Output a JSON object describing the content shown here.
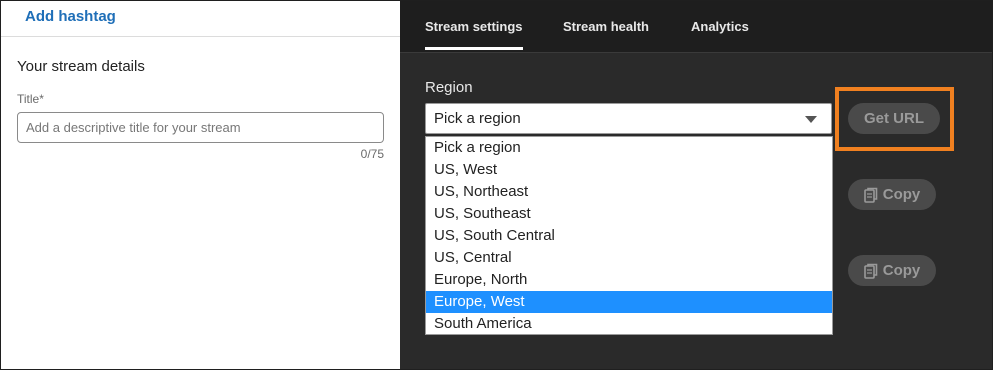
{
  "left": {
    "add_hashtag": "Add hashtag",
    "details_title": "Your stream details",
    "title_label": "Title",
    "title_required_mark": "*",
    "title_placeholder": "Add a descriptive title for your stream",
    "title_value": "",
    "char_count": "0/75"
  },
  "tabs": [
    {
      "label": "Stream settings",
      "active": true
    },
    {
      "label": "Stream health",
      "active": false
    },
    {
      "label": "Analytics",
      "active": false
    }
  ],
  "region": {
    "label": "Region",
    "selected_value": "Pick a region",
    "options": [
      "Pick a region",
      "US, West",
      "US, Northeast",
      "US, Southeast",
      "US, South Central",
      "US, Central",
      "Europe, North",
      "Europe, West",
      "South America"
    ],
    "highlighted_option": "Europe, West"
  },
  "buttons": {
    "get_url": "Get URL",
    "copy_1": "Copy",
    "copy_2": "Copy"
  },
  "colors": {
    "accent_link": "#1f6fb8",
    "highlight_outline": "#f08020",
    "option_selected": "#1e90ff",
    "dark_panel": "#2a2a2a"
  },
  "icons": {
    "copy": "copy-icon",
    "caret": "chevron-down-icon"
  }
}
